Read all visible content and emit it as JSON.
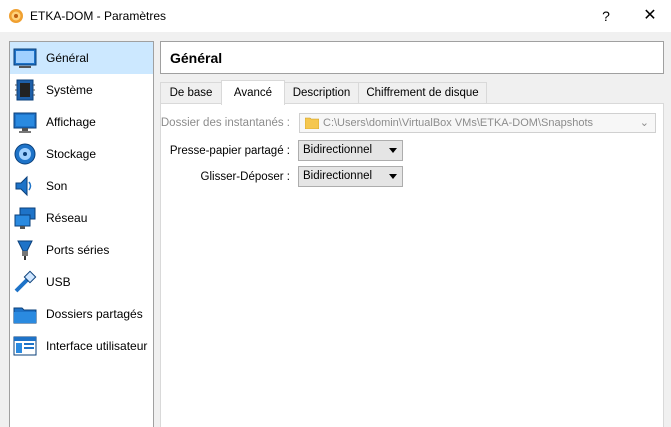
{
  "window": {
    "title": "ETKA-DOM - Paramètres",
    "help": "?",
    "close": "✕"
  },
  "sidebar": {
    "items": [
      {
        "label": "Général",
        "icon": "general-icon",
        "selected": true
      },
      {
        "label": "Système",
        "icon": "system-chip-icon"
      },
      {
        "label": "Affichage",
        "icon": "display-monitor-icon"
      },
      {
        "label": "Stockage",
        "icon": "storage-disk-icon"
      },
      {
        "label": "Son",
        "icon": "speaker-icon"
      },
      {
        "label": "Réseau",
        "icon": "network-icon"
      },
      {
        "label": "Ports séries",
        "icon": "serial-port-icon"
      },
      {
        "label": "USB",
        "icon": "usb-icon"
      },
      {
        "label": "Dossiers partagés",
        "icon": "shared-folder-icon"
      },
      {
        "label": "Interface utilisateur",
        "icon": "user-interface-icon"
      }
    ]
  },
  "main": {
    "header": "Général",
    "tabs": [
      {
        "label": "De base"
      },
      {
        "label": "Avancé",
        "active": true
      },
      {
        "label": "Description"
      },
      {
        "label": "Chiffrement de disque"
      }
    ],
    "snapshot_folder": {
      "label": "Dossier des instantanés :",
      "value": "C:\\Users\\domin\\VirtualBox VMs\\ETKA-DOM\\Snapshots"
    },
    "clipboard": {
      "label": "Presse-papier partagé :",
      "value": "Bidirectionnel"
    },
    "dragdrop": {
      "label": "Glisser-Déposer :",
      "value": "Bidirectionnel"
    }
  },
  "colors": {
    "selection": "#cce8ff",
    "accent_blue": "#1e73c8",
    "folder": "#f5c74f"
  }
}
